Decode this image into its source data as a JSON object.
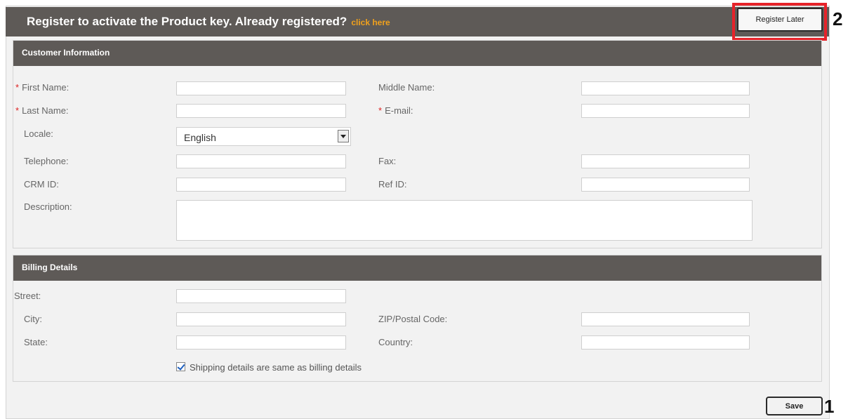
{
  "header": {
    "title": "Register to activate the Product key. Already registered?",
    "link_text": "click here",
    "register_later_label": "Register Later",
    "callout_register": "2"
  },
  "customer_info": {
    "section_title": "Customer Information",
    "first_name_label": "First Name:",
    "middle_name_label": "Middle Name:",
    "last_name_label": "Last Name:",
    "email_label": "E-mail:",
    "locale_label": "Locale:",
    "locale_value": "English",
    "telephone_label": "Telephone:",
    "fax_label": "Fax:",
    "crm_id_label": "CRM ID:",
    "ref_id_label": "Ref ID:",
    "description_label": "Description:",
    "required_marker": "*"
  },
  "billing": {
    "section_title": "Billing Details",
    "street_label": "Street:",
    "city_label": "City:",
    "zip_label": "ZIP/Postal Code:",
    "state_label": "State:",
    "country_label": "Country:",
    "shipping_same_label": "Shipping details are same as billing details",
    "shipping_same_checked": true
  },
  "footer": {
    "save_label": "Save",
    "callout_save": "1"
  },
  "colors": {
    "header_bg": "#5e5a57",
    "link": "#f0a11d",
    "highlight": "#e6232a",
    "required": "#dd2222"
  }
}
